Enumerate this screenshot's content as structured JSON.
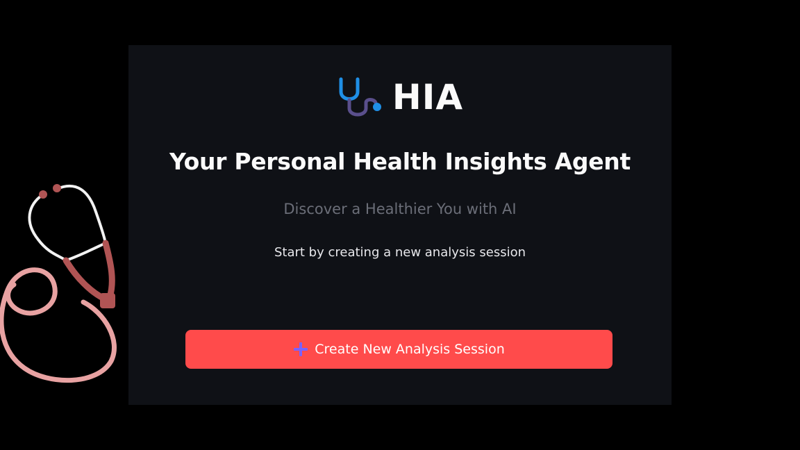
{
  "app": {
    "logo_text": "HIA",
    "logo_icon": "stethoscope-icon"
  },
  "hero": {
    "headline": "Your Personal Health Insights Agent",
    "tagline": "Discover a Healthier You with AI",
    "instructions": "Start by creating a new analysis session"
  },
  "actions": {
    "create_session_label": "Create New Analysis Session",
    "create_session_icon": "plus-icon"
  },
  "colors": {
    "page_background": "#000000",
    "panel_background": "#0f1116",
    "button_background": "#ff4b4b",
    "plus_icon": "#7b61ff",
    "logo_icon_blue": "#1f8fe6",
    "logo_icon_purple": "#5a4f8c",
    "decoration_pink": "#e8a2a2",
    "decoration_dark_red": "#b05454"
  },
  "decoration": {
    "icon": "stethoscope-icon"
  }
}
